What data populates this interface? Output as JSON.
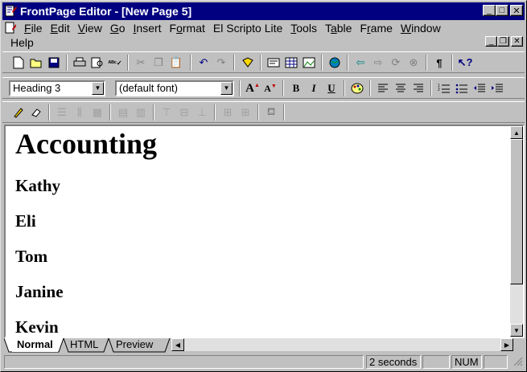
{
  "window": {
    "title": "FrontPage Editor - [New Page 5]",
    "minimize": "_",
    "maximize": "□",
    "close": "✕"
  },
  "menu": {
    "row1": [
      {
        "label": "File",
        "u": "F",
        "rest": "ile"
      },
      {
        "label": "Edit",
        "u": "E",
        "rest": "dit"
      },
      {
        "label": "View",
        "u": "V",
        "rest": "iew"
      },
      {
        "label": "Go",
        "u": "G",
        "rest": "o"
      },
      {
        "label": "Insert",
        "u": "I",
        "rest": "nsert"
      },
      {
        "label": "Format",
        "u": "F",
        "rest": "ormat"
      },
      {
        "label": "El Scripto Lite",
        "u": "",
        "rest": "El Scripto Lite"
      },
      {
        "label": "Tools",
        "u": "T",
        "rest": "ools"
      },
      {
        "label": "Table",
        "u": "a",
        "rest": "ble"
      },
      {
        "label": "Frame",
        "u": "r",
        "rest": "ame"
      },
      {
        "label": "Window",
        "u": "W",
        "rest": "indow"
      }
    ],
    "help": "Help"
  },
  "format_toolbar": {
    "style_value": "Heading 3",
    "font_value": "(default font)"
  },
  "document": {
    "heading": "Accounting",
    "names": [
      "Kathy",
      "Eli",
      "Tom",
      "Janine",
      "Kevin"
    ]
  },
  "tabs": [
    "Normal",
    "HTML",
    "Preview"
  ],
  "status": {
    "time": "2 seconds",
    "num": "NUM"
  },
  "colors": {
    "title_bar": "#000080",
    "face": "#c0c0c0"
  }
}
